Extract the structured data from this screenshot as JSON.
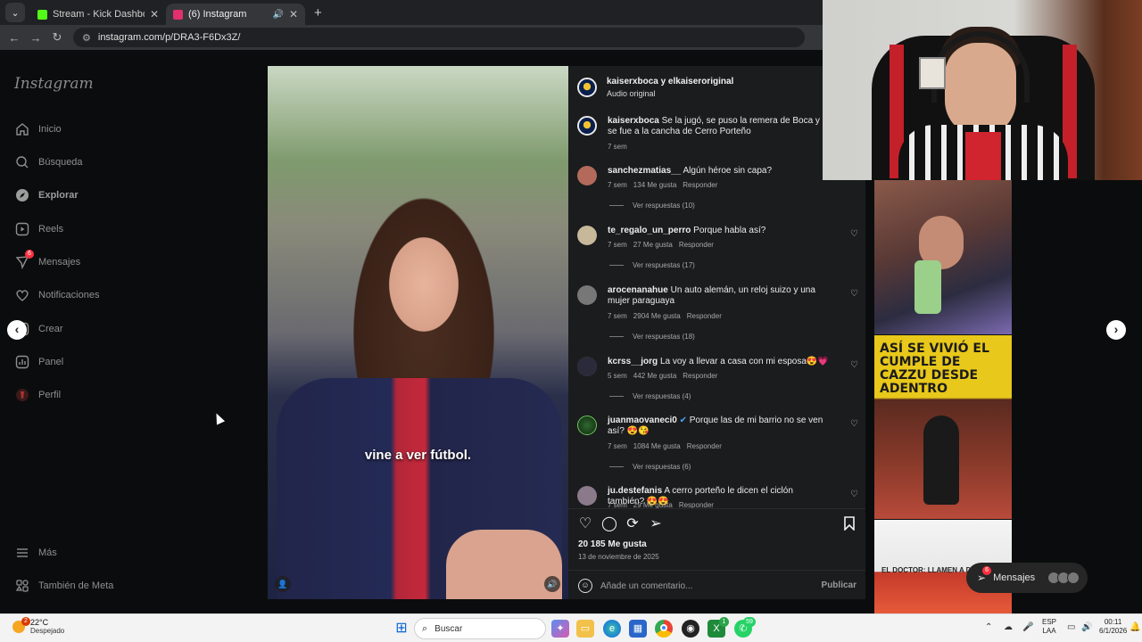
{
  "browser": {
    "tabs": [
      {
        "title": "Stream - Kick Dashboard",
        "favicon_color": "#53fc18"
      },
      {
        "title": "(6) Instagram",
        "favicon_color": "#e1306c"
      }
    ],
    "address": "instagram.com/p/DRA3-F6Dx3Z/"
  },
  "sidebar": {
    "logo": "Instagram",
    "items": [
      {
        "label": "Inicio",
        "icon": "home-icon"
      },
      {
        "label": "Búsqueda",
        "icon": "search-icon"
      },
      {
        "label": "Explorar",
        "icon": "compass-icon"
      },
      {
        "label": "Reels",
        "icon": "reels-icon"
      },
      {
        "label": "Mensajes",
        "icon": "messenger-icon",
        "badge": "6"
      },
      {
        "label": "Notificaciones",
        "icon": "heart-icon"
      },
      {
        "label": "Crear",
        "icon": "plus-icon"
      },
      {
        "label": "Panel",
        "icon": "chart-icon"
      },
      {
        "label": "Perfil",
        "icon": "profile-icon"
      }
    ],
    "bottom": [
      {
        "label": "Más",
        "icon": "menu-icon"
      },
      {
        "label": "También de Meta",
        "icon": "meta-icon"
      }
    ]
  },
  "post": {
    "caption_overlay": "vine a ver fútbol.",
    "header": {
      "authors": "kaiserxboca y elkaiseroriginal",
      "audio": "Audio original"
    },
    "description": {
      "user": "kaiserxboca",
      "text": "Se la jugó, se puso la remera de Boca y se fue a la cancha de Cerro Porteño",
      "time": "7 sem"
    },
    "comments": [
      {
        "user": "sanchezmatias__",
        "text": "Algún héroe sin capa?",
        "time": "7 sem",
        "likes": "134 Me gusta",
        "reply": "Responder",
        "replies": "Ver respuestas (10)"
      },
      {
        "user": "te_regalo_un_perro",
        "text": "Porque habla así?",
        "time": "7 sem",
        "likes": "27 Me gusta",
        "reply": "Responder",
        "replies": "Ver respuestas (17)"
      },
      {
        "user": "arocenanahue",
        "text": "Un auto alemán, un reloj suizo y una mujer paraguaya",
        "time": "7 sem",
        "likes": "2904 Me gusta",
        "reply": "Responder",
        "replies": "Ver respuestas (18)"
      },
      {
        "user": "kcrss__jorg",
        "text": "La voy a llevar a casa con mi esposa😍💗",
        "time": "5 sem",
        "likes": "442 Me gusta",
        "reply": "Responder",
        "replies": "Ver respuestas (4)"
      },
      {
        "user": "juanmaovaneci0",
        "text": "Porque las de mi barrio no se ven así? 😍😘",
        "time": "7 sem",
        "likes": "1084 Me gusta",
        "reply": "Responder",
        "replies": "Ver respuestas (6)"
      },
      {
        "user": "ju.destefanis",
        "text": "A cerro porteño le dicen el ciclón también? 😍😍",
        "time": "7 sem",
        "likes": "29 Me gusta",
        "reply": "Responder",
        "replies": ""
      }
    ],
    "likes": "20 185 Me gusta",
    "date": "13 de noviembre de 2025",
    "comment_placeholder": "Añade un comentario...",
    "publish_label": "Publicar"
  },
  "thumbnails": {
    "cazzu_text": "ASÍ SE VIVIÓ EL CUMPLE DE CAZZU DESDE ADENTRO",
    "doctor_text": "EL DOCTOR: LLAMEN A D"
  },
  "messages_pill": {
    "label": "Mensajes",
    "badge": "6"
  },
  "taskbar": {
    "weather_temp": "22°C",
    "weather_desc": "Despejado",
    "weather_badge": "2",
    "search_label": "Buscar",
    "lang1": "ESP",
    "lang2": "LAA",
    "time": "00:11",
    "date": "6/1/2026",
    "badge_green": "1",
    "badge_whatsapp": "59"
  },
  "colors": {
    "instagram_bg": "#0b0c0d",
    "panel_bg": "#1b1c1e",
    "taskbar_bg": "#f3f3f3",
    "notification_red": "#ff3040",
    "cazzu_yellow": "#e8c81a"
  }
}
